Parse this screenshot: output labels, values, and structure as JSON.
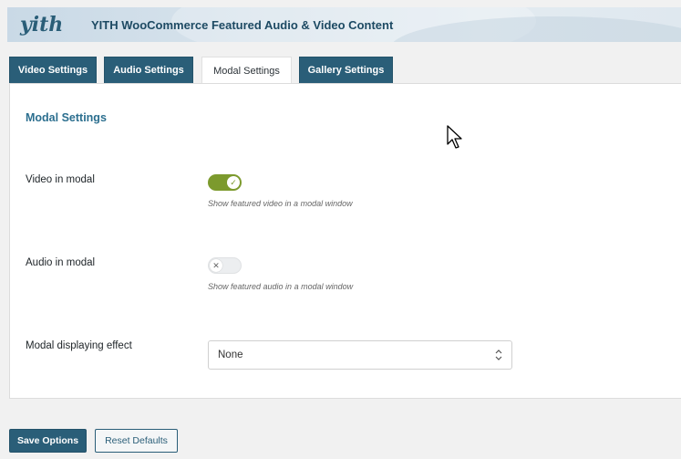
{
  "header": {
    "logo_text": "yith",
    "title": "YITH WooCommerce Featured Audio & Video Content"
  },
  "tabs": [
    {
      "label": "Video Settings",
      "active": false
    },
    {
      "label": "Audio Settings",
      "active": false
    },
    {
      "label": "Modal Settings",
      "active": true
    },
    {
      "label": "Gallery Settings",
      "active": false
    }
  ],
  "panel": {
    "section_title": "Modal Settings",
    "rows": [
      {
        "label": "Video in modal",
        "toggle_on": true,
        "description": "Show featured video in a modal window"
      },
      {
        "label": "Audio in modal",
        "toggle_on": false,
        "description": "Show featured audio in a modal window"
      },
      {
        "label": "Modal displaying effect",
        "select_value": "None"
      }
    ]
  },
  "buttons": {
    "save": "Save Options",
    "reset": "Reset Defaults"
  },
  "colors": {
    "brand": "#2a5e78",
    "toggle_on": "#7c9a2d",
    "section_title": "#2c6f8f"
  }
}
